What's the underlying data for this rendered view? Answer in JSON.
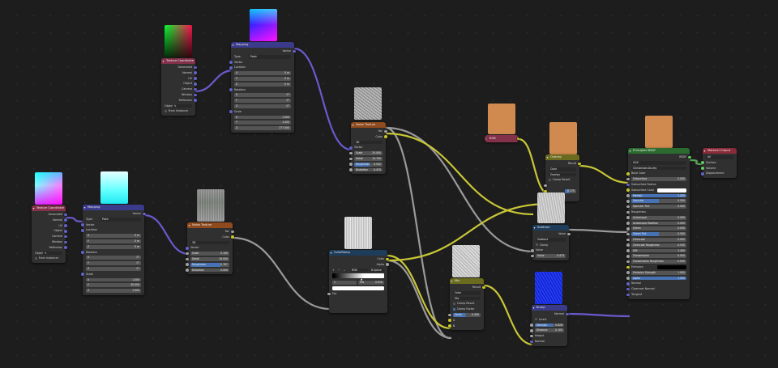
{
  "colors": {
    "header_input": "#83314a",
    "header_vector": "#3a3b8a",
    "header_texture": "#8f4a1d",
    "header_converter": "#1e3d5a",
    "header_color": "#6b6b20",
    "header_shader": "#2b6b2f",
    "header_output": "#8a2a3a",
    "socket_vector": "#6363c7",
    "socket_color": "#c7c729",
    "socket_float": "#a1a1a1",
    "socket_shader": "#63c763",
    "wire_vector": "#6a5acd",
    "wire_color": "#c8c637",
    "wire_float": "#9a9a9a",
    "wire_shader": "#5aa25a",
    "copper": "#d08a4f"
  },
  "texcoord": {
    "title": "Texture Coordinate",
    "outputs": [
      "Generated",
      "Normal",
      "UV",
      "Object",
      "Camera",
      "Window",
      "Reflection"
    ],
    "object_label": "Object",
    "from_instancer": "From Instancer"
  },
  "mapping": {
    "title": "Mapping",
    "out": "Vector",
    "type_label": "Type:",
    "type_value": "Point",
    "vector": "Vector",
    "location": "Location",
    "loc": [
      [
        "X",
        "0 m"
      ],
      [
        "Y",
        "0 m"
      ],
      [
        "Z",
        "0 m"
      ]
    ],
    "rotation": "Rotation",
    "rot": [
      [
        "X",
        "0°"
      ],
      [
        "Y",
        "0°"
      ],
      [
        "Z",
        "0°"
      ]
    ],
    "scale": "Scale",
    "scl1": [
      [
        "X",
        "1.000"
      ],
      [
        "Y",
        "1.000"
      ],
      [
        "Z",
        "277.000"
      ]
    ],
    "scl2": [
      [
        "X",
        "1.000"
      ],
      [
        "Y",
        "30.000"
      ],
      [
        "Z",
        "1.000"
      ]
    ]
  },
  "noise": {
    "title": "Noise Texture",
    "outs": [
      "Fac",
      "Color"
    ],
    "dim": "3D",
    "vector": "Vector",
    "scale_l": "Scale",
    "detail_l": "Detail",
    "rough_l": "Roughness",
    "dist_l": "Distortion",
    "a": {
      "scale": "25.000",
      "detail": "14.700",
      "rough": "0.542",
      "dist": "0.470"
    },
    "b": {
      "scale": "0.100",
      "detail": "16.000",
      "rough": "0.767",
      "dist": "0.000"
    }
  },
  "ramp": {
    "title": "ColorRamp",
    "outs": [
      "Color",
      "Alpha"
    ],
    "plus": "+",
    "minus": "−",
    "mode": "RGB",
    "interp": "B-Spline",
    "pos_l": "1",
    "pos_l2": "Pos",
    "pos_v": "0.616",
    "fac": "Fac"
  },
  "mix1": {
    "title": "Mix",
    "out": "Result",
    "data_type": "Color",
    "blend": "Mix",
    "clamp_result": "Clamp Result",
    "clamp_factor": "Clamp Factor",
    "factor_l": "Factor",
    "factor_v": "0.450",
    "a": "A",
    "b": "B"
  },
  "rgb": {
    "out": "RGB"
  },
  "mix2": {
    "title": "Overlay",
    "out": "Result",
    "data_type": "Color",
    "blend": "Overlay",
    "clamp": "Clamp Result",
    "factor_v": "0.370"
  },
  "math": {
    "title": "Subtract",
    "out": "Value",
    "op": "Subtract",
    "clamp": "Clamp",
    "value_l": "Value",
    "value_v": "0.473"
  },
  "bump": {
    "title": "Bump",
    "out": "Normal",
    "invert": "Invert",
    "strength_l": "Strength",
    "strength_v": "0.628",
    "distance_l": "Distance",
    "distance_v": "0.100",
    "height": "Height",
    "normal": "Normal"
  },
  "bsdf": {
    "title": "Principled BSDF",
    "out": "BSDF",
    "dist": "GGX",
    "sss": "Christensen-Burley",
    "rows": [
      [
        "Base Color",
        ""
      ],
      [
        "Subsurface",
        "0.000"
      ],
      [
        "Subsurface Radius",
        ""
      ],
      [
        "Subsurface Color",
        ""
      ],
      [
        "Metallic",
        "1.000"
      ],
      [
        "Specular",
        "0.500"
      ],
      [
        "Specular Tint",
        "0.000"
      ],
      [
        "Roughness",
        ""
      ],
      [
        "Anisotropic",
        "0.000"
      ],
      [
        "Anisotropic Rotation",
        "0.000"
      ],
      [
        "Sheen",
        "0.000"
      ],
      [
        "Sheen Tint",
        "0.500"
      ],
      [
        "Clearcoat",
        "0.000"
      ],
      [
        "Clearcoat Roughness",
        "0.030"
      ],
      [
        "IOR",
        "1.450"
      ],
      [
        "Transmission",
        "0.000"
      ],
      [
        "Transmission Roughness",
        "0.000"
      ],
      [
        "Emission",
        ""
      ],
      [
        "Emission Strength",
        "1.000"
      ],
      [
        "Alpha",
        "1.000"
      ],
      [
        "Normal",
        ""
      ],
      [
        "Clearcoat Normal",
        ""
      ],
      [
        "Tangent",
        ""
      ]
    ]
  },
  "output": {
    "title": "Material Output",
    "target": "All",
    "ins": [
      "Surface",
      "Volume",
      "Displacement"
    ]
  }
}
